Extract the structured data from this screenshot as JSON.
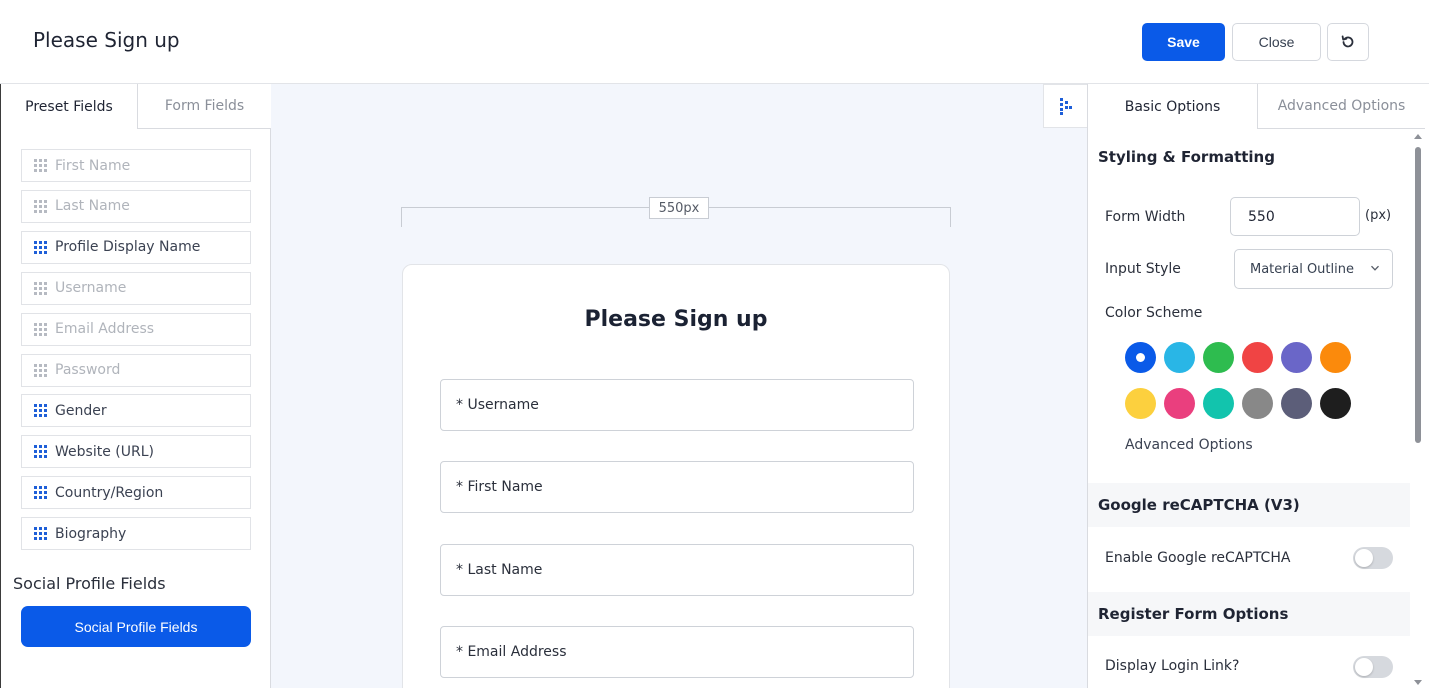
{
  "header": {
    "title": "Please Sign up",
    "save_label": "Save",
    "close_label": "Close"
  },
  "left_panel": {
    "tabs": [
      {
        "label": "Preset Fields",
        "active": true
      },
      {
        "label": "Form Fields",
        "active": false
      }
    ],
    "fields": [
      {
        "label": "First Name",
        "enabled": false
      },
      {
        "label": "Last Name",
        "enabled": false
      },
      {
        "label": "Profile Display Name",
        "enabled": true
      },
      {
        "label": "Username",
        "enabled": false
      },
      {
        "label": "Email Address",
        "enabled": false
      },
      {
        "label": "Password",
        "enabled": false
      },
      {
        "label": "Gender",
        "enabled": true
      },
      {
        "label": "Website (URL)",
        "enabled": true
      },
      {
        "label": "Country/Region",
        "enabled": true
      },
      {
        "label": "Biography",
        "enabled": true
      }
    ],
    "social_title": "Social Profile Fields",
    "social_button": "Social Profile Fields"
  },
  "canvas": {
    "width_label": "550px",
    "form_title": "Please Sign up",
    "inputs": [
      "* Username",
      "* First Name",
      "* Last Name",
      "* Email Address"
    ]
  },
  "right_panel": {
    "tabs": [
      {
        "label": "Basic Options",
        "active": true
      },
      {
        "label": "Advanced Options",
        "active": false
      }
    ],
    "styling_heading": "Styling & Formatting",
    "form_width_label": "Form Width",
    "form_width_value": "550",
    "form_width_unit": "(px)",
    "input_style_label": "Input Style",
    "input_style_value": "Material Outline",
    "color_scheme_label": "Color Scheme",
    "color_scheme": [
      "#0a5ae8",
      "#29b6e6",
      "#2ebc4f",
      "#f04444",
      "#6a66c8",
      "#fb8a0c",
      "#fcd03e",
      "#ea3f7e",
      "#12c4ad",
      "#888888",
      "#5c5e79",
      "#1e1e1e"
    ],
    "selected_color": "#0a5ae8",
    "advanced_options_link": "Advanced Options",
    "recaptcha_heading": "Google reCAPTCHA (V3)",
    "recaptcha_label": "Enable Google reCAPTCHA",
    "recaptcha_enabled": false,
    "register_heading": "Register Form Options",
    "login_link_label": "Display Login Link?",
    "login_link_enabled": false
  }
}
